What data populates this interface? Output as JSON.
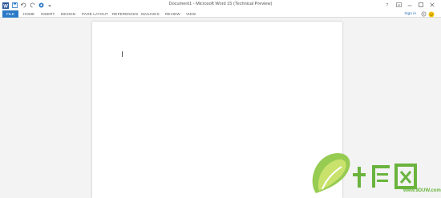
{
  "titlebar": {
    "title": "Document1 - Microsoft Word 15 (Technical Preview)",
    "qat_icons": [
      "word-app-icon",
      "save-icon",
      "undo-icon",
      "redo-icon",
      "touch-mode-icon",
      "customize-qat-icon"
    ],
    "window_controls": [
      "help-icon",
      "ribbon-display-options-icon",
      "minimize-icon",
      "maximize-icon",
      "close-icon"
    ]
  },
  "ribbon": {
    "tabs": [
      {
        "label": "FILE",
        "active": true
      },
      {
        "label": "HOME"
      },
      {
        "label": "INSERT"
      },
      {
        "label": "DESIGN"
      },
      {
        "label": "PAGE LAYOUT"
      },
      {
        "label": "REFERENCES"
      },
      {
        "label": "MAILINGS"
      },
      {
        "label": "REVIEW"
      },
      {
        "label": "VIEW"
      }
    ],
    "sign_in": "Sign in",
    "right_icons": [
      "sync-icon",
      "smiley-feedback-icon"
    ]
  },
  "colors": {
    "accent": "#2b79c7",
    "workspace_bg": "#f3f3f3",
    "watermark_green": "#6ab43e"
  },
  "watermark": {
    "text": "www.9DUW.com"
  }
}
